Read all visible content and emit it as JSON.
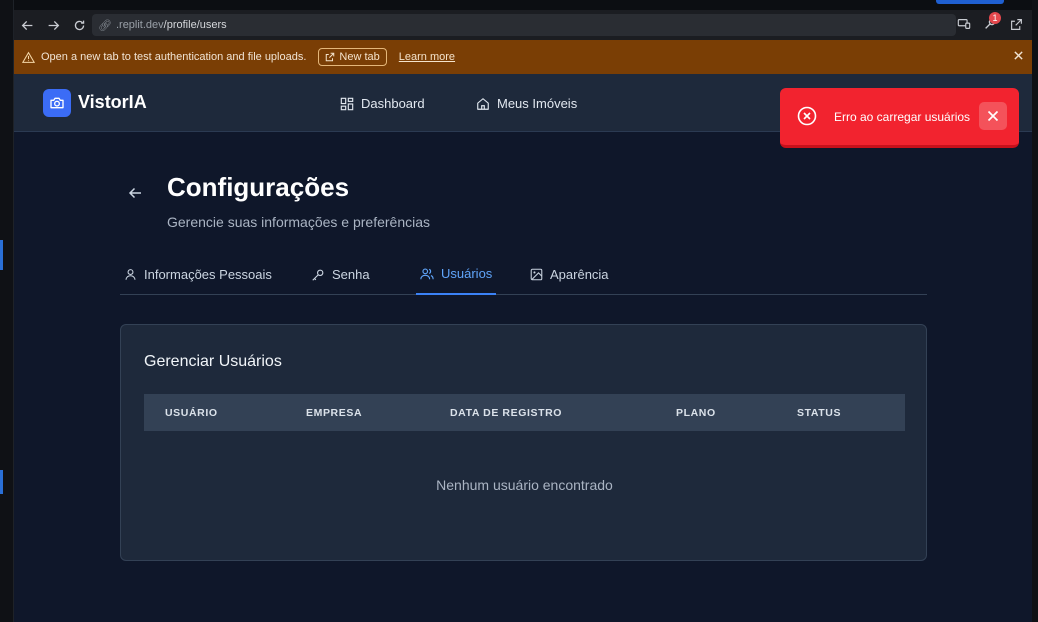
{
  "browser": {
    "url_prefix": ".replit.dev",
    "url_path": "/profile/users",
    "notification_count": "1"
  },
  "banner": {
    "message": "Open a new tab to test authentication and file uploads.",
    "new_tab_label": "New tab",
    "learn_more_label": "Learn more"
  },
  "header": {
    "brand": "VistorIA",
    "nav": [
      {
        "label": "Dashboard"
      },
      {
        "label": "Meus Imóveis"
      }
    ]
  },
  "toast": {
    "message": "Erro ao carregar usuários"
  },
  "page": {
    "title": "Configurações",
    "subtitle": "Gerencie suas informações e preferências"
  },
  "tabs": [
    {
      "label": "Informações Pessoais"
    },
    {
      "label": "Senha"
    },
    {
      "label": "Usuários",
      "active": true
    },
    {
      "label": "Aparência"
    }
  ],
  "users_card": {
    "title": "Gerenciar Usuários",
    "columns": [
      "USUÁRIO",
      "EMPRESA",
      "DATA DE REGISTRO",
      "PLANO",
      "STATUS"
    ],
    "empty_message": "Nenhum usuário encontrado"
  },
  "colors": {
    "accent": "#3b82f6",
    "toast_error": "#f2232f",
    "banner": "#7a3e05",
    "app_bg": "#0f172a"
  }
}
